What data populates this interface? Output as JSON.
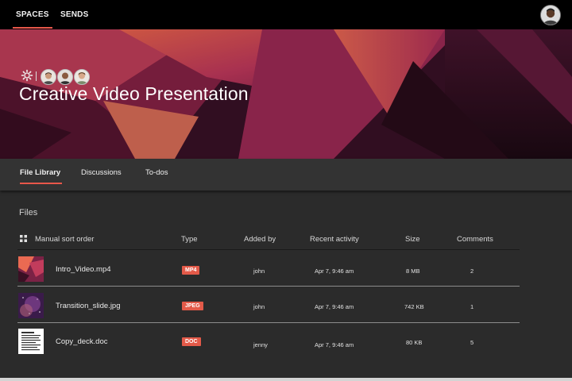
{
  "topnav": {
    "tabs": [
      {
        "label": "SPACES",
        "active": true
      },
      {
        "label": "SENDS",
        "active": false
      }
    ]
  },
  "hero": {
    "title": "Creative Video Presentation",
    "member_count": 3
  },
  "subtabs": [
    {
      "label": "File Library",
      "active": true
    },
    {
      "label": "Discussions",
      "active": false
    },
    {
      "label": "To-dos",
      "active": false
    }
  ],
  "files": {
    "section_title": "Files",
    "columns": {
      "name": "Manual sort order",
      "type": "Type",
      "added_by": "Added by",
      "recent_activity": "Recent activity",
      "size": "Size",
      "comments": "Comments"
    },
    "rows": [
      {
        "name": "Intro_Video.mp4",
        "type": "MP4",
        "added_by": "john",
        "activity": "Apr 7, 9:46 am",
        "size": "8 MB",
        "comments": "2"
      },
      {
        "name": "Transition_slide.jpg",
        "type": "JPEG",
        "added_by": "john",
        "activity": "Apr 7, 9:46 am",
        "size": "742 KB",
        "comments": "1"
      },
      {
        "name": "Copy_deck.doc",
        "type": "DOC",
        "added_by": "jenny",
        "activity": "Apr 7, 9:46 am",
        "size": "80 KB",
        "comments": "5"
      }
    ]
  },
  "colors": {
    "accent": "#e8574a",
    "badge": "#e35a49",
    "topbar": "#000000",
    "background": "#2b2b2b"
  }
}
